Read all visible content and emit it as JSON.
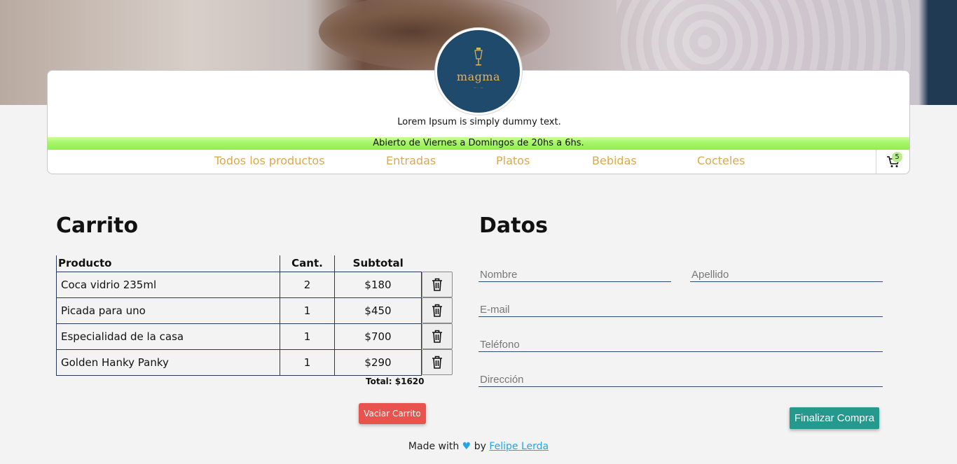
{
  "header": {
    "brand": "magma",
    "tagline": "Lorem Ipsum is simply dummy text.",
    "hours": "Abierto de Viernes a Domingos de 20hs a 6hs."
  },
  "nav": {
    "items": [
      "Todos los productos",
      "Entradas",
      "Platos",
      "Bebidas",
      "Cocteles"
    ],
    "cart_count": "5"
  },
  "cart": {
    "title": "Carrito",
    "headers": {
      "product": "Producto",
      "qty": "Cant.",
      "subtotal": "Subtotal"
    },
    "rows": [
      {
        "product": "Coca vidrio 235ml",
        "qty": "2",
        "subtotal": "$180"
      },
      {
        "product": "Picada para uno",
        "qty": "1",
        "subtotal": "$450"
      },
      {
        "product": "Especialidad de la casa",
        "qty": "1",
        "subtotal": "$700"
      },
      {
        "product": "Golden Hanky Panky",
        "qty": "1",
        "subtotal": "$290"
      }
    ],
    "total": "Total: $1620",
    "empty_label": "Vaciar Carrito"
  },
  "form": {
    "title": "Datos",
    "name_placeholder": "Nombre",
    "surname_placeholder": "Apellido",
    "email_placeholder": "E-mail",
    "phone_placeholder": "Teléfono",
    "address_placeholder": "Dirección",
    "submit_label": "Finalizar Compra"
  },
  "footer": {
    "made_with": "Made with",
    "heart": "♥",
    "by": "by",
    "author": "Felipe Lerda"
  },
  "colors": {
    "accent_nav": "#d9a94e",
    "hours_bar": "#a7f46a",
    "empty_button": "#e9534f",
    "submit_button": "#26998f",
    "logo_bg": "#1f4a6b"
  }
}
